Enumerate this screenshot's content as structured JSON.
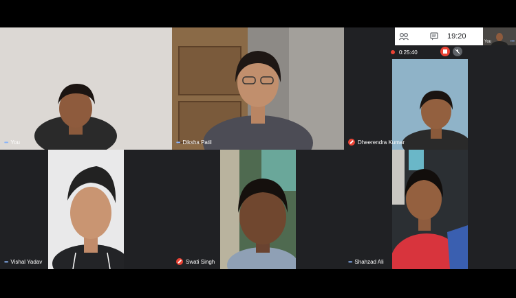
{
  "topbar": {
    "people_icon": "people-icon",
    "chat_icon": "chat-icon",
    "clock": "19:20",
    "self_label": "You"
  },
  "recording": {
    "timer": "0:25:40"
  },
  "tiles": [
    {
      "name": "You"
    },
    {
      "name": "Diksha Patil"
    },
    {
      "name": "Dheerendra Kumar"
    },
    {
      "name": "Vishal Yadav"
    },
    {
      "name": "Swati Singh"
    },
    {
      "name": "Shahzad Ali"
    }
  ],
  "colors": {
    "background": "#000000",
    "tile": "#202124",
    "muted_red": "#ea4335",
    "audio_blue": "#8ab4f8"
  }
}
